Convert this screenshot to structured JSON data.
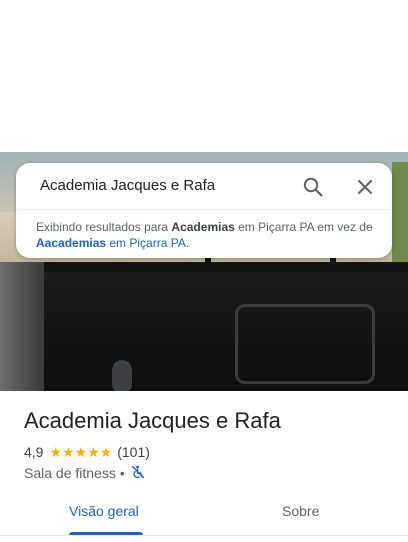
{
  "search": {
    "query": "Academia Jacques e Rafa",
    "search_icon": "search-icon",
    "close_icon": "close-icon",
    "notice": {
      "prefix": "Exibindo resultados para ",
      "term1": "Academias",
      "middle": " em Piçarra PA em vez de ",
      "term2": "Aacademias",
      "suffix": " em Piçarra PA."
    }
  },
  "place": {
    "title": "Academia Jacques e Rafa",
    "rating": "4,9",
    "stars": "★★★★★",
    "reviews": "(101)",
    "category": "Sala de fitness",
    "separator": "•",
    "accessibility_icon": "not-accessible-icon"
  },
  "tabs": [
    {
      "label": "Visão geral",
      "active": true
    },
    {
      "label": "Sobre",
      "active": false
    }
  ],
  "colors": {
    "accent": "#1a62d6",
    "star": "#f4b400",
    "text": "#202124",
    "secondary": "#5f6368"
  }
}
